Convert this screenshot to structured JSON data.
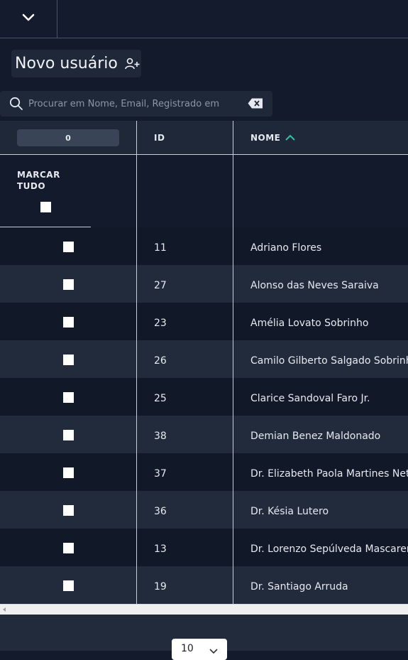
{
  "header": {
    "collapse_icon": "chevron-down-icon"
  },
  "actions": {
    "new_user_label": "Novo usuário",
    "new_user_icon": "person-add-icon"
  },
  "search": {
    "placeholder": "Procurar em Nome, Email, Registrado em",
    "value": "",
    "icon": "search-icon",
    "clear_icon": "backspace-icon"
  },
  "table": {
    "selected_count": "0",
    "columns": {
      "id": "ID",
      "name": "NOME"
    },
    "sort": {
      "column": "name",
      "direction": "ascending",
      "color": "#2ec4a0"
    },
    "mark_all_label": "MARCAR TUDO",
    "rows": [
      {
        "id": "11",
        "name": "Adriano Flores",
        "checked": false
      },
      {
        "id": "27",
        "name": "Alonso das Neves Saraiva",
        "checked": false
      },
      {
        "id": "23",
        "name": "Amélia Lovato Sobrinho",
        "checked": false
      },
      {
        "id": "26",
        "name": "Camilo Gilberto Salgado Sobrinho",
        "checked": false
      },
      {
        "id": "25",
        "name": "Clarice Sandoval Faro Jr.",
        "checked": false
      },
      {
        "id": "38",
        "name": "Demian Benez Maldonado",
        "checked": false
      },
      {
        "id": "37",
        "name": "Dr. Elizabeth Paola Martines Neto",
        "checked": false
      },
      {
        "id": "36",
        "name": "Dr. Késia Lutero",
        "checked": false
      },
      {
        "id": "13",
        "name": "Dr. Lorenzo Sepúlveda Mascarenhas",
        "checked": false
      },
      {
        "id": "19",
        "name": "Dr. Santiago Arruda",
        "checked": false
      }
    ]
  },
  "pagination": {
    "page_size": "10"
  },
  "colors": {
    "background": "#131a2b",
    "panel": "#1f2839",
    "row_alt": "#222b3c",
    "accent": "#2ec4a0"
  }
}
